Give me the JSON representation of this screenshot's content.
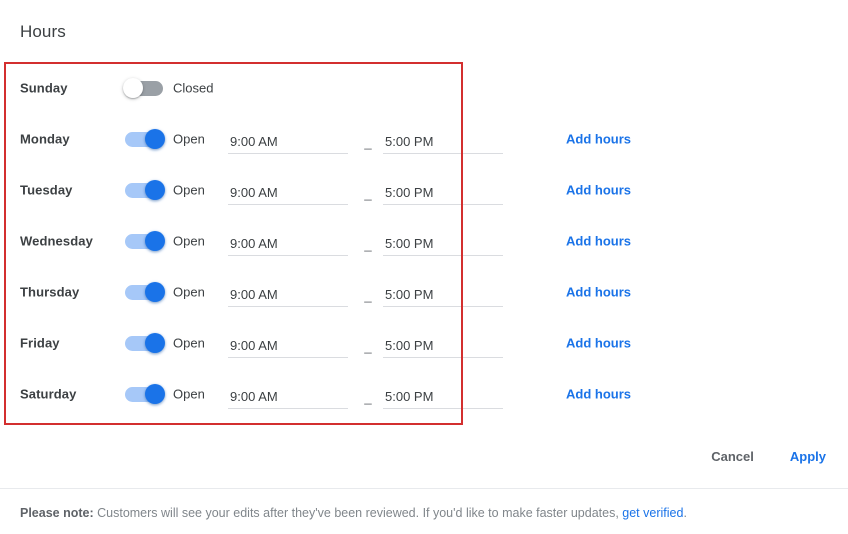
{
  "header": {
    "title": "Hours"
  },
  "labels": {
    "open": "Open",
    "closed": "Closed",
    "add_hours": "Add hours",
    "time_separator": "_"
  },
  "days": [
    {
      "name": "Sunday",
      "state": "Closed",
      "is_open": false,
      "open_time": "",
      "close_time": "",
      "add_hours": ""
    },
    {
      "name": "Monday",
      "state": "Open",
      "is_open": true,
      "open_time": "9:00 AM",
      "close_time": "5:00 PM",
      "add_hours": "Add hours"
    },
    {
      "name": "Tuesday",
      "state": "Open",
      "is_open": true,
      "open_time": "9:00 AM",
      "close_time": "5:00 PM",
      "add_hours": "Add hours"
    },
    {
      "name": "Wednesday",
      "state": "Open",
      "is_open": true,
      "open_time": "9:00 AM",
      "close_time": "5:00 PM",
      "add_hours": "Add hours"
    },
    {
      "name": "Thursday",
      "state": "Open",
      "is_open": true,
      "open_time": "9:00 AM",
      "close_time": "5:00 PM",
      "add_hours": "Add hours"
    },
    {
      "name": "Friday",
      "state": "Open",
      "is_open": true,
      "open_time": "9:00 AM",
      "close_time": "5:00 PM",
      "add_hours": "Add hours"
    },
    {
      "name": "Saturday",
      "state": "Open",
      "is_open": true,
      "open_time": "9:00 AM",
      "close_time": "5:00 PM",
      "add_hours": "Add hours"
    }
  ],
  "footer": {
    "cancel_label": "Cancel",
    "apply_label": "Apply",
    "note_strong": "Please note:",
    "note_text": " Customers will see your edits after they've been reviewed. If you'd like to make faster updates, ",
    "note_link": "get verified",
    "note_suffix": "."
  },
  "colors": {
    "accent_blue": "#1a73e8",
    "toggle_on_track": "#a6c8f8",
    "toggle_off_track": "#9aa0a6",
    "annotation_red": "#d32f2f",
    "text_primary": "#3c4043",
    "text_secondary": "#5f6368",
    "text_muted": "#80868b"
  }
}
